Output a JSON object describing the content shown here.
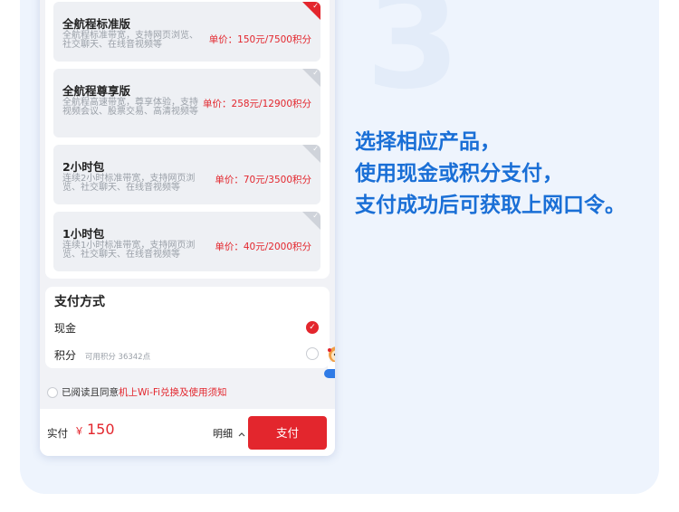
{
  "step_number": "3",
  "caption_lines": [
    "选择相应产品，",
    "使用现金或积分支付，",
    "支付成功后可获取上网口令。"
  ],
  "products": [
    {
      "title": "全航程标准版",
      "description": "全航程标准带宽，支持网页浏览、社交聊天、在线音视频等",
      "price": "单价：150元/7500积分",
      "selected": true
    },
    {
      "title": "全航程尊享版",
      "description": "全航程高速带宽，尊享体验，支持视频会议、股票交易、高清视频等",
      "price": "单价：258元/12900积分",
      "selected": false
    },
    {
      "title": "2小时包",
      "description": "连续2小时标准带宽，支持网页浏览、社交聊天、在线音视频等",
      "price": "单价：70元/3500积分",
      "selected": false
    },
    {
      "title": "1小时包",
      "description": "连续1小时标准带宽，支持网页浏览、社交聊天、在线音视频等",
      "price": "单价：40元/2000积分",
      "selected": false
    }
  ],
  "payment": {
    "title": "支付方式",
    "cash_label": "现金",
    "points_label": "积分",
    "points_available": "可用积分 36342点",
    "selected": "cash"
  },
  "agreement": {
    "prefix": "已阅读且同意",
    "link": "机上Wi-Fi兑换及使用须知"
  },
  "checkout": {
    "label": "实付",
    "currency": "￥",
    "amount": "150",
    "detail_label": "明细",
    "pay_button": "支付"
  },
  "colors": {
    "accent_red": "#e3262d",
    "caption_blue": "#1a6fd6",
    "panel_bg": "#eef4fd"
  },
  "icons": {
    "selected_corner": "check-corner-icon",
    "radio_checked": "check-icon",
    "detail_toggle": "chevron-up-icon",
    "assistant": "mascot-icon"
  }
}
